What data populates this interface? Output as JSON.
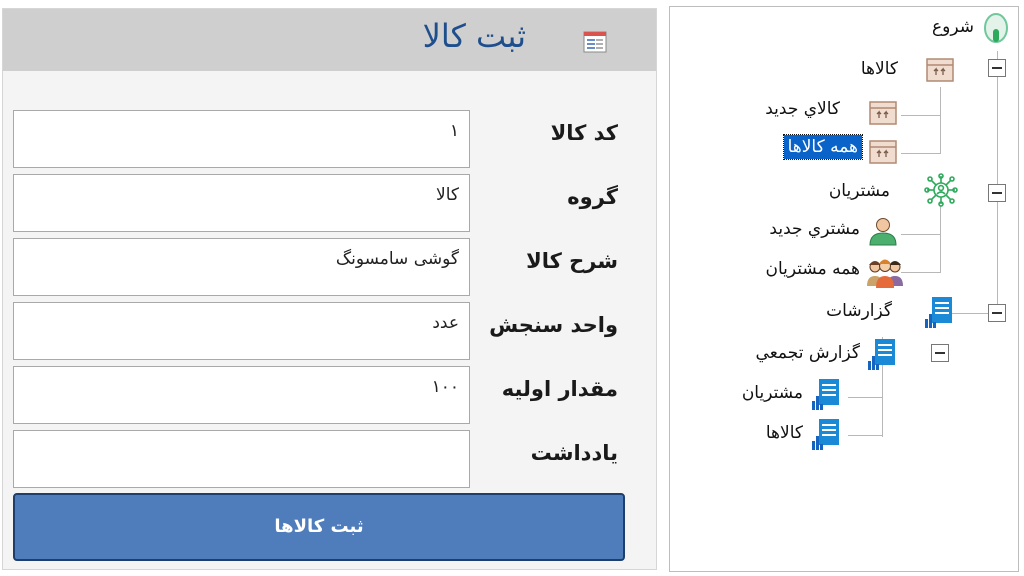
{
  "form": {
    "title": "ثبت كالا",
    "fields": [
      {
        "label": "كد كالا",
        "value": "١"
      },
      {
        "label": "گروه",
        "value": "كالا"
      },
      {
        "label": "شرح كالا",
        "value": "گوشى سامسونگ"
      },
      {
        "label": "واحد سنجش",
        "value": "عدد"
      },
      {
        "label": "مقدار اوليه",
        "value": "١٠٠"
      },
      {
        "label": "يادداشت",
        "value": ""
      }
    ],
    "submit_label": "ثبت كالاها"
  },
  "tree": {
    "root": "شروع",
    "items": {
      "goods": "كالاها",
      "new_good": "كالاي جديد",
      "all_goods": "همه كالاها",
      "customers": "مشتريان",
      "new_customer": "مشتري جديد",
      "all_customers": "همه مشتريان",
      "reports": "گزارشات",
      "summary_report": "گزارش تجمعي",
      "report_customers": "مشتريان",
      "report_goods": "كالاها"
    },
    "selected": "همه كالاها"
  },
  "colors": {
    "title": "#1f4e8c",
    "submit_bg": "#4f7dbb",
    "selection": "#0a63c8",
    "customers_icon": "#2eaa5c",
    "report_icon": "#1b8ad6"
  },
  "icons": {
    "form": "form-icon",
    "start": "start-icon",
    "goods": "box-icon",
    "customers": "network-icon",
    "person": "person-icon",
    "group": "group-icon",
    "report": "report-icon"
  }
}
